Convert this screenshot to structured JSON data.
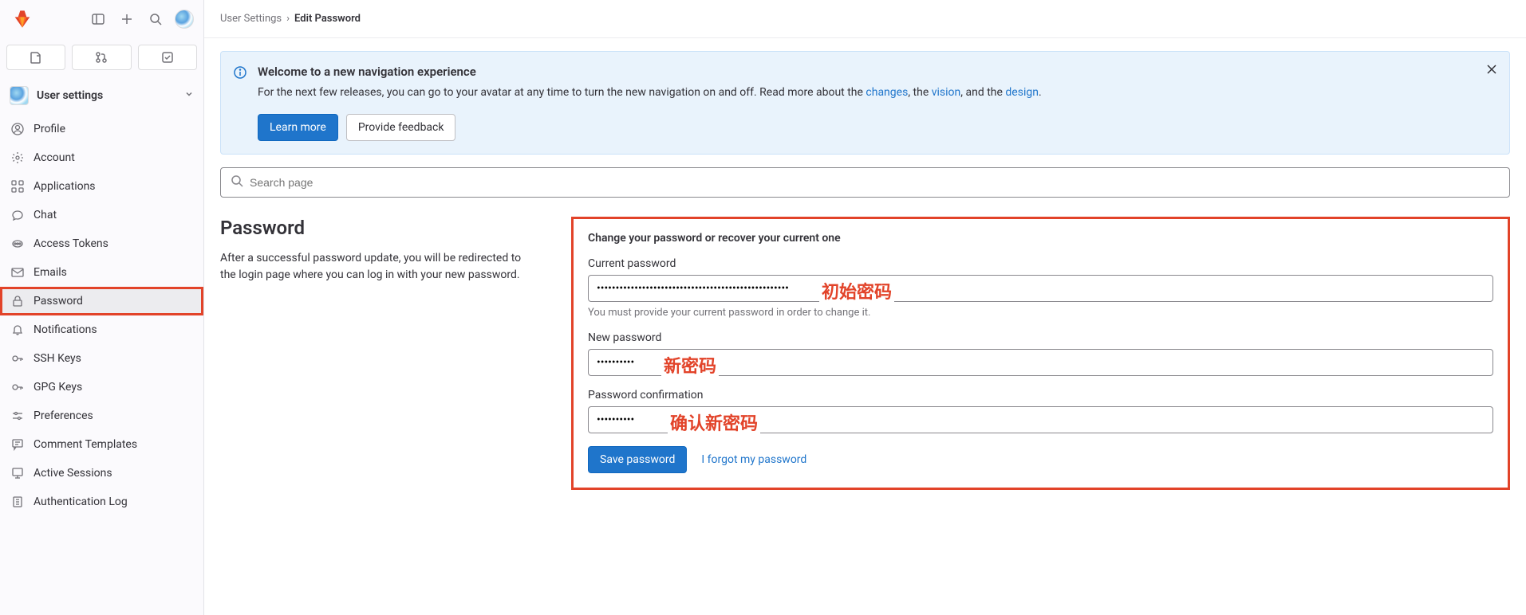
{
  "breadcrumb": {
    "root": "User Settings",
    "sep": "›",
    "current": "Edit Password"
  },
  "sidebar": {
    "context_label": "User settings",
    "items": [
      {
        "label": "Profile",
        "icon": "user"
      },
      {
        "label": "Account",
        "icon": "account"
      },
      {
        "label": "Applications",
        "icon": "apps"
      },
      {
        "label": "Chat",
        "icon": "chat"
      },
      {
        "label": "Access Tokens",
        "icon": "token"
      },
      {
        "label": "Emails",
        "icon": "mail"
      },
      {
        "label": "Password",
        "icon": "lock",
        "active": true,
        "highlighted": true
      },
      {
        "label": "Notifications",
        "icon": "bell"
      },
      {
        "label": "SSH Keys",
        "icon": "key"
      },
      {
        "label": "GPG Keys",
        "icon": "key"
      },
      {
        "label": "Preferences",
        "icon": "prefs"
      },
      {
        "label": "Comment Templates",
        "icon": "comment"
      },
      {
        "label": "Active Sessions",
        "icon": "sessions"
      },
      {
        "label": "Authentication Log",
        "icon": "log"
      }
    ]
  },
  "banner": {
    "title": "Welcome to a new navigation experience",
    "text_pre": "For the next few releases, you can go to your avatar at any time to turn the new navigation on and off. Read more about the ",
    "link1": "changes",
    "text_mid1": ", the ",
    "link2": "vision",
    "text_mid2": ", and the ",
    "link3": "design",
    "text_post": ".",
    "learn_more": "Learn more",
    "feedback": "Provide feedback"
  },
  "search": {
    "placeholder": "Search page"
  },
  "page": {
    "title": "Password",
    "desc": "After a successful password update, you will be redirected to the login page where you can log in with your new password."
  },
  "form": {
    "heading": "Change your password or recover your current one",
    "current_label": "Current password",
    "current_value": "•••••••••••••••••••••••••••••••••••••••••••••••••••",
    "current_hint": "You must provide your current password in order to change it.",
    "new_label": "New password",
    "new_value": "••••••••••",
    "confirm_label": "Password confirmation",
    "confirm_value": "••••••••••",
    "save": "Save password",
    "forgot": "I forgot my password"
  },
  "annotations": {
    "a1": "初始密码",
    "a2": "新密码",
    "a3": "确认新密码"
  }
}
